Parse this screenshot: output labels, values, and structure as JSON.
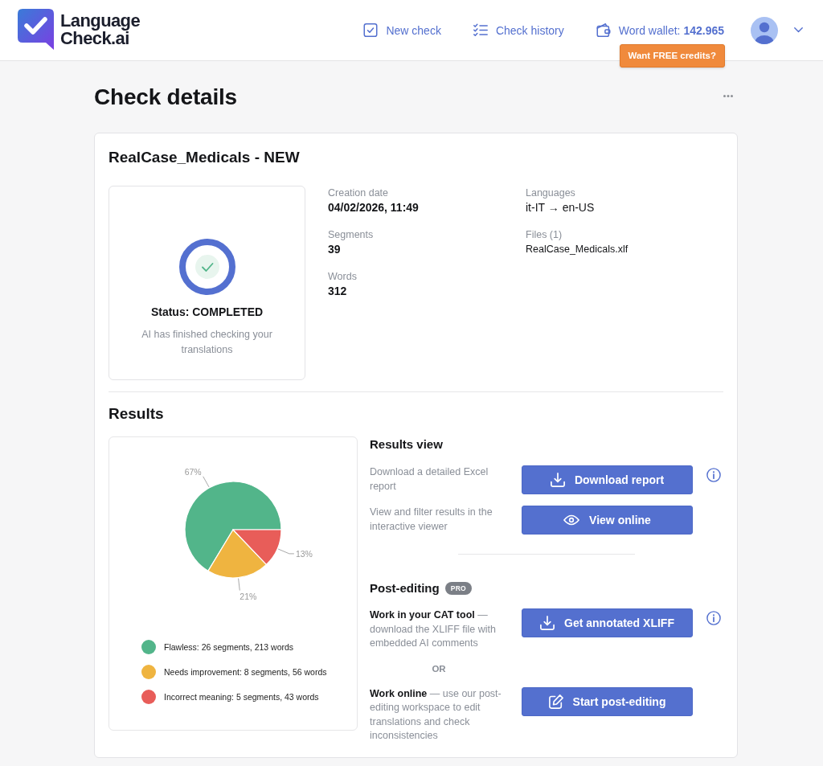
{
  "header": {
    "logo": "Language Check.ai",
    "nav": [
      {
        "kind": "new-check",
        "label": "New check"
      },
      {
        "kind": "history",
        "label": "Check history"
      },
      {
        "kind": "wallet",
        "label": "Word wallet: **142.965**",
        "promo": "Want FREE credits?"
      }
    ]
  },
  "page": {
    "title": "Check details"
  },
  "check": {
    "title": "RealCase_Medicals - NEW",
    "status": {
      "label": "Status: COMPLETED",
      "description": "AI has finished checking your translations"
    },
    "details": [
      [
        {
          "label": "Creation date",
          "value": "04/02/2026, 11:49",
          "kind": "stat"
        },
        {
          "label": "Segments",
          "value": "39",
          "kind": "stat"
        },
        {
          "label": "Words",
          "value": "312",
          "kind": "stat"
        }
      ],
      [
        {
          "label": "Languages",
          "value": "it-IT → en-US",
          "kind": "text"
        },
        {
          "label": "Files (1)",
          "value": "RealCase_Medicals.xlf",
          "kind": "file"
        }
      ]
    ]
  },
  "results": {
    "title": "Results",
    "chart_data": {
      "type": "pie",
      "categories": [
        "Flawless: 26 segments, 213 words",
        "Needs improvement: 8 segments, 56 words",
        "Incorrect meaning: 5 segments, 43 words"
      ],
      "values": [
        67,
        21,
        13
      ],
      "value_labels": [
        "67%",
        "21%",
        "13%"
      ],
      "colors": [
        "#52b58a",
        "#efb440",
        "#e85d59"
      ],
      "legend": "bottom"
    },
    "view": {
      "title": "Results view",
      "rows": [
        {
          "kind": "option",
          "text": "Download a detailed Excel report",
          "button": {
            "label": "Download report",
            "kind": "download"
          },
          "info": true
        },
        {
          "kind": "option",
          "text": "View and filter results in the interactive viewer",
          "button": {
            "label": "View online",
            "kind": "view"
          },
          "info": false
        }
      ]
    },
    "post_editing": {
      "title": "Post-editing",
      "badge": "PRO",
      "rows": [
        {
          "kind": "option",
          "text": "**Work in your CAT tool** — download the XLIFF file with embedded AI comments",
          "button": {
            "label": "Get annotated XLIFF",
            "kind": "download"
          },
          "info": true
        },
        {
          "kind": "separator",
          "text": "OR"
        },
        {
          "kind": "option",
          "text": "**Work online** — use our post-editing workspace to edit translations and check inconsistencies",
          "button": {
            "label": "Start post-editing",
            "kind": "edit"
          },
          "info": false
        }
      ]
    }
  }
}
